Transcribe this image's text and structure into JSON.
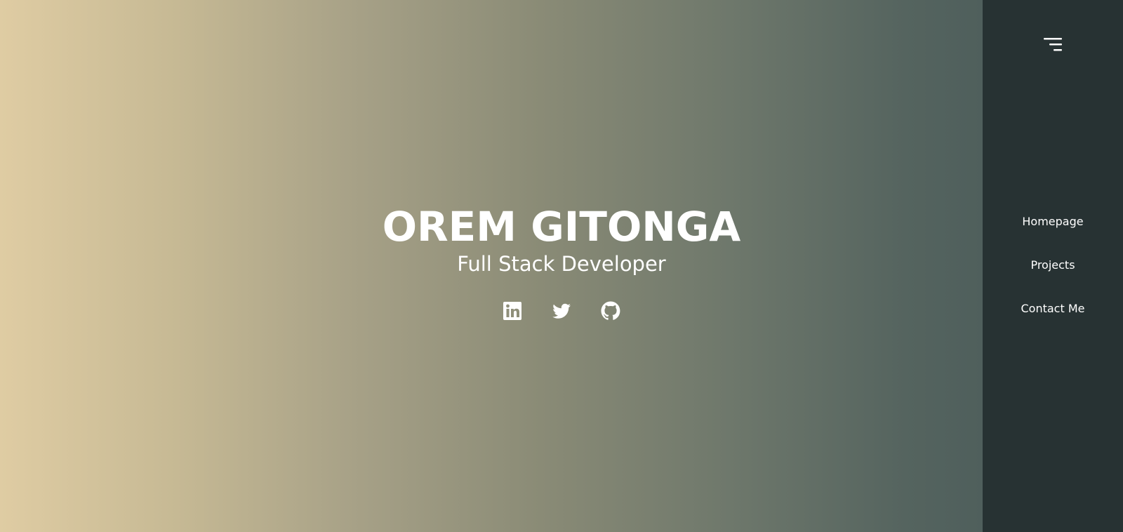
{
  "hero": {
    "name": "OREM GITONGA",
    "role": "Full Stack Developer",
    "socials": [
      {
        "icon": "linkedin-icon"
      },
      {
        "icon": "twitter-icon"
      },
      {
        "icon": "github-icon"
      }
    ]
  },
  "sidebar": {
    "menu_icon": "menu-icon",
    "items": [
      {
        "label": "Homepage"
      },
      {
        "label": "Projects"
      },
      {
        "label": "Contact Me"
      }
    ]
  },
  "colors": {
    "gradient_start": "#dfcca3",
    "gradient_end": "#4f5f5c",
    "sidebar_bg": "#273233",
    "text": "#ffffff"
  }
}
